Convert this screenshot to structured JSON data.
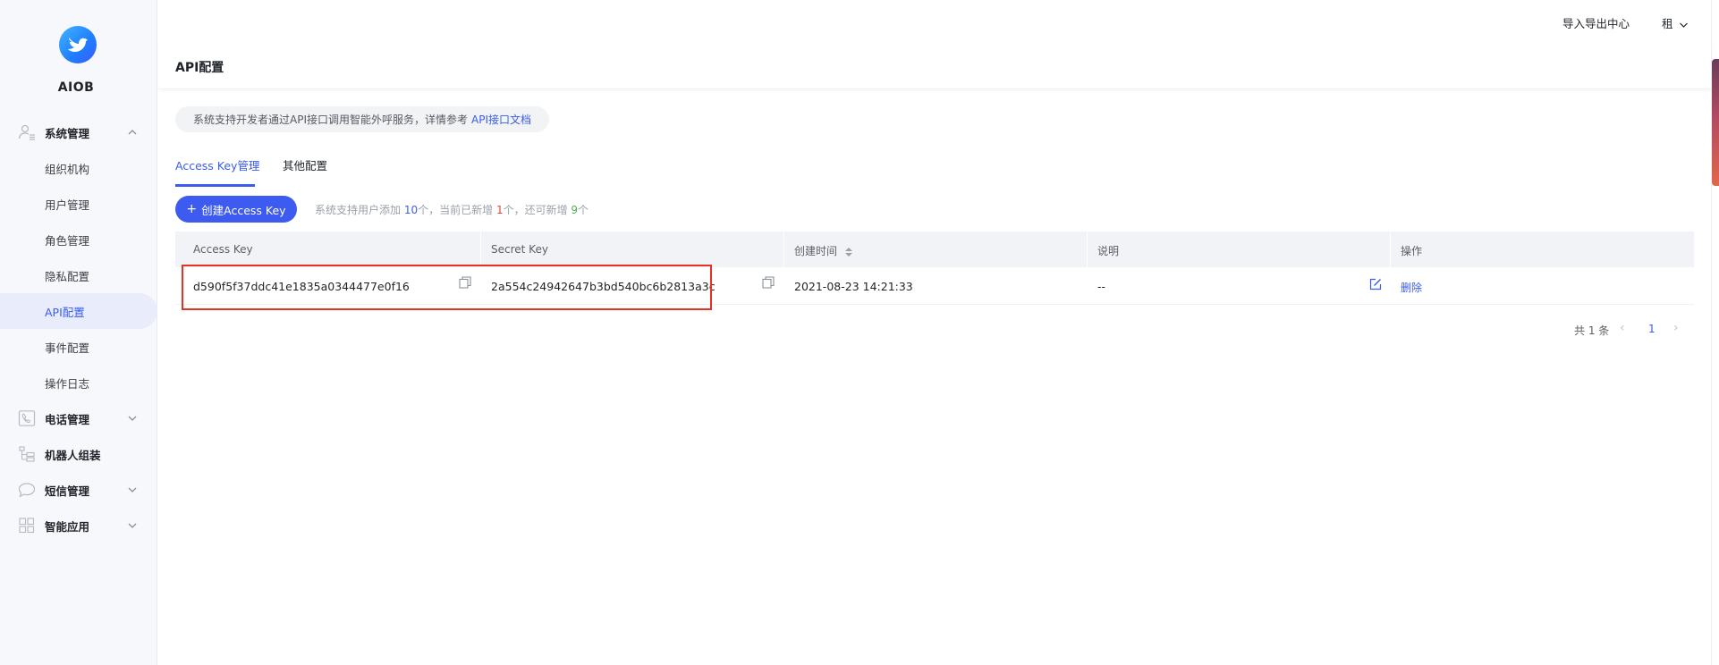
{
  "app": {
    "name": "AIOB"
  },
  "topbar": {
    "import_export": "导入导出中心",
    "tenant": "租"
  },
  "page": {
    "title": "API配置"
  },
  "sidebar": {
    "groups": [
      {
        "label": "系统管理",
        "icon": "user-settings-icon",
        "expanded": true,
        "items": [
          "组织机构",
          "用户管理",
          "角色管理",
          "隐私配置",
          "API配置",
          "事件配置",
          "操作日志"
        ]
      },
      {
        "label": "电话管理",
        "icon": "phone-icon",
        "expanded": false
      },
      {
        "label": "机器人组装",
        "icon": "robot-tree-icon"
      },
      {
        "label": "短信管理",
        "icon": "message-icon",
        "expanded": false
      },
      {
        "label": "智能应用",
        "icon": "apps-grid-icon",
        "expanded": false
      }
    ],
    "active_item": "API配置"
  },
  "notice": {
    "text": "系统支持开发者通过API接口调用智能外呼服务，详情参考",
    "link": "API接口文档"
  },
  "tabs": [
    {
      "label": "Access Key管理",
      "active": true
    },
    {
      "label": "其他配置",
      "active": false
    }
  ],
  "create_button": {
    "label": "创建Access Key"
  },
  "quota": {
    "p1": "系统支持用户添加 ",
    "max": "10",
    "p2": "个，当前已新增 ",
    "used": "1",
    "p3": "个，还可新增 ",
    "left": "9",
    "p4": "个"
  },
  "table": {
    "columns": [
      "Access Key",
      "Secret Key",
      "创建时间",
      "说明",
      "操作"
    ],
    "rows": [
      {
        "access_key": "d590f5f37ddc41e1835a0344477e0f16",
        "secret_key": "2a554c24942647b3bd540bc6b2813a3c",
        "created": "2021-08-23 14:21:33",
        "desc": "--",
        "action_delete": "删除"
      }
    ]
  },
  "pagination": {
    "total": "共 1 条",
    "current": "1"
  },
  "colors": {
    "accent": "#3a5bef",
    "sidebar_bg": "#f7f8fc",
    "highlight_box": "#e53222"
  }
}
